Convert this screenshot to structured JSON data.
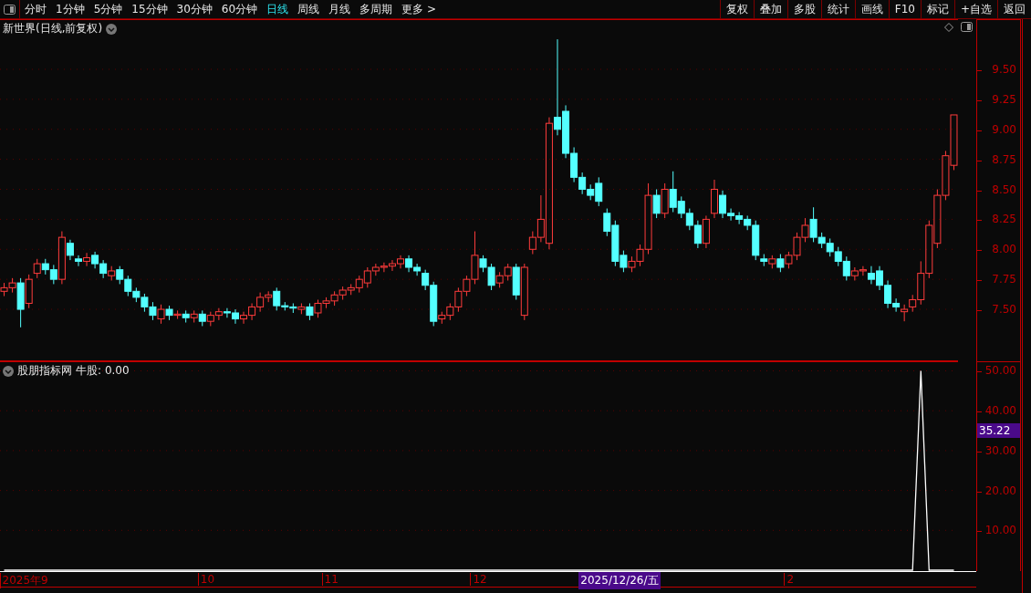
{
  "toolbar": {
    "periods": [
      {
        "label": "分时",
        "selected": false
      },
      {
        "label": "1分钟",
        "selected": false
      },
      {
        "label": "5分钟",
        "selected": false
      },
      {
        "label": "15分钟",
        "selected": false
      },
      {
        "label": "30分钟",
        "selected": false
      },
      {
        "label": "60分钟",
        "selected": false
      },
      {
        "label": "日线",
        "selected": true
      },
      {
        "label": "周线",
        "selected": false
      },
      {
        "label": "月线",
        "selected": false
      },
      {
        "label": "多周期",
        "selected": false
      }
    ],
    "more": {
      "label": "更多",
      "arrow": ">"
    },
    "buttons": [
      "复权",
      "叠加",
      "多股",
      "统计",
      "画线",
      "F10",
      "标记",
      "+自选",
      "返回"
    ]
  },
  "main_chart": {
    "title": "新世界(日线,前复权)",
    "chart_data": {
      "type": "candlestick",
      "ylim": [
        7.067,
        9.918
      ],
      "grid": true,
      "yticks": [
        {
          "value": 7.5,
          "label": "7.50"
        },
        {
          "value": 7.75,
          "label": "7.75"
        },
        {
          "value": 8,
          "label": "8.00"
        },
        {
          "value": 8.25,
          "label": "8.25"
        },
        {
          "value": 8.5,
          "label": "8.50"
        },
        {
          "value": 8.75,
          "label": "8.75"
        },
        {
          "value": 9,
          "label": "9.00"
        },
        {
          "value": 9.25,
          "label": "9.25"
        },
        {
          "value": 9.5,
          "label": "9.50"
        }
      ],
      "ohlc": [
        [
          7.65,
          7.72,
          7.61,
          7.68
        ],
        [
          7.68,
          7.76,
          7.64,
          7.72
        ],
        [
          7.72,
          7.76,
          7.35,
          7.5
        ],
        [
          7.55,
          7.79,
          7.51,
          7.75
        ],
        [
          7.8,
          7.92,
          7.76,
          7.88
        ],
        [
          7.88,
          7.92,
          7.79,
          7.83
        ],
        [
          7.83,
          7.87,
          7.71,
          7.75
        ],
        [
          7.75,
          8.15,
          7.71,
          8.1
        ],
        [
          8.05,
          8.08,
          7.91,
          7.95
        ],
        [
          7.92,
          7.95,
          7.86,
          7.9
        ],
        [
          7.9,
          7.97,
          7.86,
          7.93
        ],
        [
          7.95,
          7.98,
          7.84,
          7.88
        ],
        [
          7.88,
          7.91,
          7.76,
          7.8
        ],
        [
          7.78,
          7.86,
          7.74,
          7.82
        ],
        [
          7.83,
          7.86,
          7.71,
          7.75
        ],
        [
          7.75,
          7.78,
          7.61,
          7.65
        ],
        [
          7.65,
          7.68,
          7.56,
          7.6
        ],
        [
          7.6,
          7.63,
          7.48,
          7.52
        ],
        [
          7.52,
          7.56,
          7.41,
          7.45
        ],
        [
          7.42,
          7.54,
          7.38,
          7.5
        ],
        [
          7.5,
          7.53,
          7.41,
          7.45
        ],
        [
          7.45,
          7.49,
          7.42,
          7.46
        ],
        [
          7.46,
          7.49,
          7.39,
          7.43
        ],
        [
          7.43,
          7.49,
          7.39,
          7.46
        ],
        [
          7.46,
          7.49,
          7.36,
          7.4
        ],
        [
          7.4,
          7.48,
          7.36,
          7.45
        ],
        [
          7.45,
          7.51,
          7.41,
          7.48
        ],
        [
          7.48,
          7.51,
          7.43,
          7.47
        ],
        [
          7.47,
          7.5,
          7.38,
          7.42
        ],
        [
          7.42,
          7.48,
          7.38,
          7.45
        ],
        [
          7.45,
          7.55,
          7.41,
          7.52
        ],
        [
          7.52,
          7.64,
          7.48,
          7.6
        ],
        [
          7.6,
          7.65,
          7.56,
          7.62
        ],
        [
          7.65,
          7.68,
          7.49,
          7.53
        ],
        [
          7.53,
          7.56,
          7.49,
          7.52
        ],
        [
          7.52,
          7.55,
          7.47,
          7.51
        ],
        [
          7.5,
          7.55,
          7.46,
          7.52
        ],
        [
          7.52,
          7.55,
          7.41,
          7.45
        ],
        [
          7.47,
          7.58,
          7.43,
          7.55
        ],
        [
          7.55,
          7.6,
          7.51,
          7.57
        ],
        [
          7.57,
          7.65,
          7.53,
          7.62
        ],
        [
          7.62,
          7.69,
          7.58,
          7.66
        ],
        [
          7.66,
          7.71,
          7.62,
          7.68
        ],
        [
          7.68,
          7.78,
          7.64,
          7.75
        ],
        [
          7.72,
          7.85,
          7.68,
          7.82
        ],
        [
          7.82,
          7.88,
          7.78,
          7.85
        ],
        [
          7.85,
          7.89,
          7.81,
          7.86
        ],
        [
          7.86,
          7.91,
          7.82,
          7.88
        ],
        [
          7.88,
          7.95,
          7.84,
          7.92
        ],
        [
          7.92,
          7.95,
          7.81,
          7.85
        ],
        [
          7.85,
          7.88,
          7.78,
          7.82
        ],
        [
          7.8,
          7.83,
          7.66,
          7.7
        ],
        [
          7.7,
          7.73,
          7.36,
          7.4
        ],
        [
          7.42,
          7.48,
          7.38,
          7.45
        ],
        [
          7.45,
          7.55,
          7.41,
          7.52
        ],
        [
          7.52,
          7.68,
          7.48,
          7.65
        ],
        [
          7.65,
          7.78,
          7.61,
          7.75
        ],
        [
          7.75,
          8.15,
          7.71,
          7.95
        ],
        [
          7.92,
          7.95,
          7.81,
          7.85
        ],
        [
          7.85,
          7.88,
          7.66,
          7.7
        ],
        [
          7.72,
          7.81,
          7.68,
          7.78
        ],
        [
          7.78,
          7.88,
          7.74,
          7.85
        ],
        [
          7.85,
          7.88,
          7.58,
          7.62
        ],
        [
          7.45,
          7.88,
          7.41,
          7.85
        ],
        [
          8.0,
          8.15,
          7.96,
          8.1
        ],
        [
          8.1,
          8.45,
          8.06,
          8.25
        ],
        [
          8.05,
          9.1,
          8.0,
          9.05
        ],
        [
          9.1,
          9.75,
          8.95,
          9.0
        ],
        [
          9.15,
          9.2,
          8.76,
          8.8
        ],
        [
          8.8,
          8.85,
          8.56,
          8.6
        ],
        [
          8.6,
          8.64,
          8.46,
          8.5
        ],
        [
          8.5,
          8.54,
          8.41,
          8.45
        ],
        [
          8.55,
          8.6,
          8.36,
          8.4
        ],
        [
          8.3,
          8.34,
          8.11,
          8.15
        ],
        [
          8.2,
          8.24,
          7.86,
          7.9
        ],
        [
          7.95,
          7.99,
          7.81,
          7.85
        ],
        [
          7.85,
          7.94,
          7.81,
          7.9
        ],
        [
          7.9,
          8.04,
          7.86,
          8.0
        ],
        [
          8.0,
          8.55,
          7.96,
          8.45
        ],
        [
          8.45,
          8.5,
          8.26,
          8.3
        ],
        [
          8.3,
          8.55,
          8.26,
          8.5
        ],
        [
          8.5,
          8.65,
          8.31,
          8.35
        ],
        [
          8.4,
          8.44,
          8.26,
          8.3
        ],
        [
          8.3,
          8.34,
          8.16,
          8.2
        ],
        [
          8.2,
          8.24,
          8.01,
          8.05
        ],
        [
          8.05,
          8.28,
          8.01,
          8.25
        ],
        [
          8.3,
          8.58,
          8.26,
          8.5
        ],
        [
          8.45,
          8.49,
          8.26,
          8.3
        ],
        [
          8.3,
          8.34,
          8.24,
          8.28
        ],
        [
          8.28,
          8.31,
          8.21,
          8.25
        ],
        [
          8.25,
          8.28,
          8.16,
          8.2
        ],
        [
          8.2,
          8.24,
          7.91,
          7.95
        ],
        [
          7.92,
          7.96,
          7.86,
          7.9
        ],
        [
          7.88,
          7.95,
          7.84,
          7.92
        ],
        [
          7.92,
          7.96,
          7.81,
          7.85
        ],
        [
          7.88,
          7.98,
          7.84,
          7.95
        ],
        [
          7.95,
          8.14,
          7.91,
          8.1
        ],
        [
          8.1,
          8.26,
          8.06,
          8.2
        ],
        [
          8.25,
          8.35,
          8.06,
          8.1
        ],
        [
          8.1,
          8.14,
          8.01,
          8.05
        ],
        [
          8.05,
          8.09,
          7.94,
          7.98
        ],
        [
          7.98,
          8.02,
          7.86,
          7.9
        ],
        [
          7.9,
          7.94,
          7.74,
          7.78
        ],
        [
          7.78,
          7.85,
          7.74,
          7.82
        ],
        [
          7.82,
          7.86,
          7.78,
          7.83
        ],
        [
          7.8,
          7.86,
          7.71,
          7.75
        ],
        [
          7.82,
          7.86,
          7.66,
          7.7
        ],
        [
          7.7,
          7.74,
          7.51,
          7.55
        ],
        [
          7.55,
          7.59,
          7.48,
          7.52
        ],
        [
          7.48,
          7.54,
          7.4,
          7.5
        ],
        [
          7.52,
          7.62,
          7.48,
          7.58
        ],
        [
          7.58,
          7.9,
          7.54,
          7.8
        ],
        [
          7.8,
          8.24,
          7.76,
          8.2
        ],
        [
          8.05,
          8.5,
          8.01,
          8.45
        ],
        [
          8.45,
          8.82,
          8.41,
          8.78
        ],
        [
          8.7,
          9.12,
          8.66,
          9.12
        ]
      ]
    }
  },
  "indicator": {
    "name": "股朋指标网",
    "reading": "0.00",
    "cursor_value": "35.22",
    "chart_data": {
      "type": "line",
      "grid": true,
      "ylim": [
        0,
        52.4
      ],
      "yticks": [
        {
          "value": 10,
          "label": "10.00"
        },
        {
          "value": 20,
          "label": "20.00"
        },
        {
          "value": 30,
          "label": "30.00"
        },
        {
          "value": 40,
          "label": "40.00"
        },
        {
          "value": 50,
          "label": "50.00"
        }
      ],
      "series": [
        {
          "name": "牛股:",
          "color": "#ffffff",
          "values": [
            0,
            0,
            0,
            0,
            0,
            0,
            0,
            0,
            0,
            0,
            0,
            0,
            0,
            0,
            0,
            0,
            0,
            0,
            0,
            0,
            0,
            0,
            0,
            0,
            0,
            0,
            0,
            0,
            0,
            0,
            0,
            0,
            0,
            0,
            0,
            0,
            0,
            0,
            0,
            0,
            0,
            0,
            0,
            0,
            0,
            0,
            0,
            0,
            0,
            0,
            0,
            0,
            0,
            0,
            0,
            0,
            0,
            0,
            0,
            0,
            0,
            0,
            0,
            0,
            0,
            0,
            0,
            0,
            0,
            0,
            0,
            0,
            0,
            0,
            0,
            0,
            0,
            0,
            0,
            0,
            0,
            0,
            0,
            0,
            0,
            0,
            0,
            0,
            0,
            0,
            0,
            0,
            0,
            0,
            0,
            0,
            0,
            0,
            0,
            0,
            0,
            0,
            0,
            0,
            0,
            0,
            0,
            0,
            0,
            0,
            0,
            50,
            0,
            0,
            0,
            0
          ]
        }
      ]
    }
  },
  "date_axis": {
    "labels": [
      "2025年9",
      "10",
      "11",
      "12",
      "2"
    ],
    "cursor": "2025/12/26/五"
  }
}
